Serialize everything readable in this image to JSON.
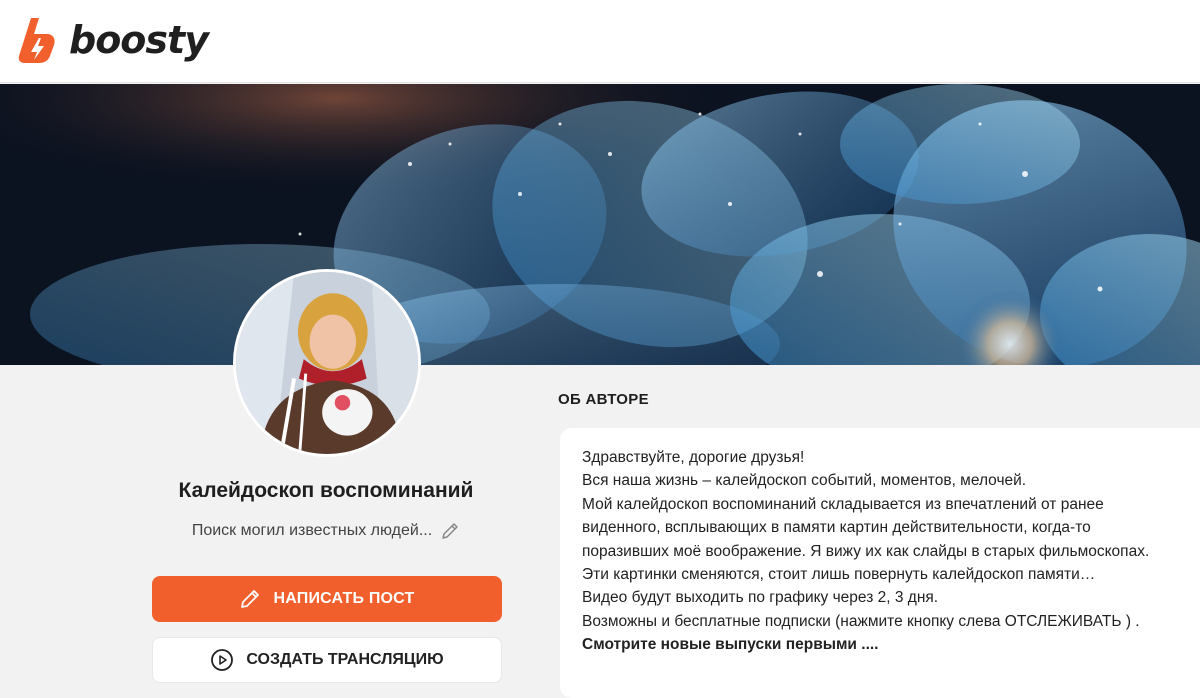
{
  "header": {
    "logo_text": "boosty"
  },
  "profile": {
    "title": "Калейдоскоп воспоминаний",
    "status": "Поиск могил известных людей..."
  },
  "actions": {
    "write_post": "НАПИСАТЬ ПОСТ",
    "create_stream": "СОЗДАТЬ ТРАНСЛЯЦИЮ"
  },
  "about": {
    "heading": "ОБ АВТОРЕ",
    "lines": [
      "Здравствуйте, дорогие друзья!",
      "Вся наша жизнь – калейдоскоп событий, моментов, мелочей.",
      "Мой калейдоскоп воспоминаний складывается из впечатлений от ранее",
      "виденного, всплывающих в памяти картин действительности, когда-то",
      "поразивших моё воображение. Я вижу их как слайды в старых фильмоскопах.",
      "Эти картинки сменяются, стоит лишь повернуть калейдоскоп памяти…",
      "Видео  будут выходить по графику через 2, 3 дня.",
      "Возможны и бесплатные подписки (нажмите кнопку слева ОТСЛЕЖИВАТЬ ) ."
    ],
    "bold_line": "Смотрите новые выпуски первыми ...."
  },
  "colors": {
    "accent": "#f15f2c",
    "cover_dark": "#0b1220",
    "cover_blue": "#3fa8e6"
  },
  "icons": {
    "logo": "boosty-lightning-icon",
    "edit": "pencil-icon",
    "stream": "play-circle-icon"
  }
}
